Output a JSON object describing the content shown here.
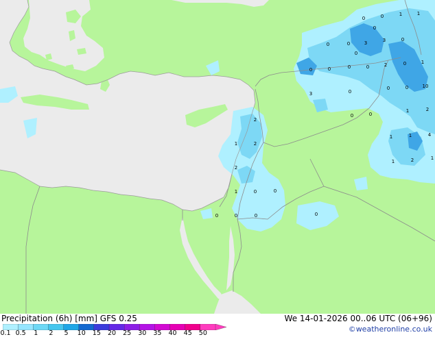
{
  "title": "Precipitation (6h) [mm] GFS 0.25",
  "run": "We 14-01-2026 00..06 UTC (06+96)",
  "credit": "©weatheronline.co.uk",
  "scale": {
    "labels": [
      "0.1",
      "0.5",
      "1",
      "2",
      "5",
      "10",
      "15",
      "20",
      "25",
      "30",
      "35",
      "40",
      "45",
      "50"
    ],
    "colors": [
      "#aff0ff",
      "#96e6ff",
      "#6ed8f5",
      "#46c6ee",
      "#1fa6e6",
      "#1469d0",
      "#3c3cdc",
      "#6428e6",
      "#8c1ee6",
      "#b414e6",
      "#d20ad2",
      "#e600b4",
      "#f0008c",
      "#ff3cbe"
    ]
  },
  "colors": {
    "land": "#b7f59b",
    "sea": "#ebebeb",
    "border": "#8c8c8c",
    "light_rain": "#aff0ff",
    "moderate_rain": "#7dd8f5",
    "heavy_rain": "#3fa6e6"
  },
  "values": [
    {
      "label": "0"
    },
    {
      "label": "1"
    },
    {
      "label": "1"
    },
    {
      "label": "0"
    },
    {
      "label": "0"
    },
    {
      "label": "0"
    },
    {
      "label": "0"
    },
    {
      "label": "0"
    },
    {
      "label": "3"
    },
    {
      "label": "0"
    },
    {
      "label": "3"
    },
    {
      "label": "0"
    },
    {
      "label": "0"
    },
    {
      "label": "2"
    },
    {
      "label": "0"
    },
    {
      "label": "1"
    },
    {
      "label": "0"
    },
    {
      "label": "0"
    },
    {
      "label": "0"
    },
    {
      "label": "3"
    },
    {
      "label": "10"
    },
    {
      "label": "0"
    },
    {
      "label": "0"
    },
    {
      "label": "1"
    },
    {
      "label": "2"
    },
    {
      "label": "0"
    },
    {
      "label": "0"
    },
    {
      "label": "2"
    },
    {
      "label": "1"
    },
    {
      "label": "1"
    },
    {
      "label": "4"
    },
    {
      "label": "1"
    },
    {
      "label": "2"
    },
    {
      "label": "1"
    },
    {
      "label": "1"
    },
    {
      "label": "2"
    },
    {
      "label": "2"
    },
    {
      "label": "1"
    },
    {
      "label": "0"
    },
    {
      "label": "0"
    },
    {
      "label": "0"
    },
    {
      "label": "0"
    },
    {
      "label": "0"
    },
    {
      "label": "0"
    }
  ]
}
